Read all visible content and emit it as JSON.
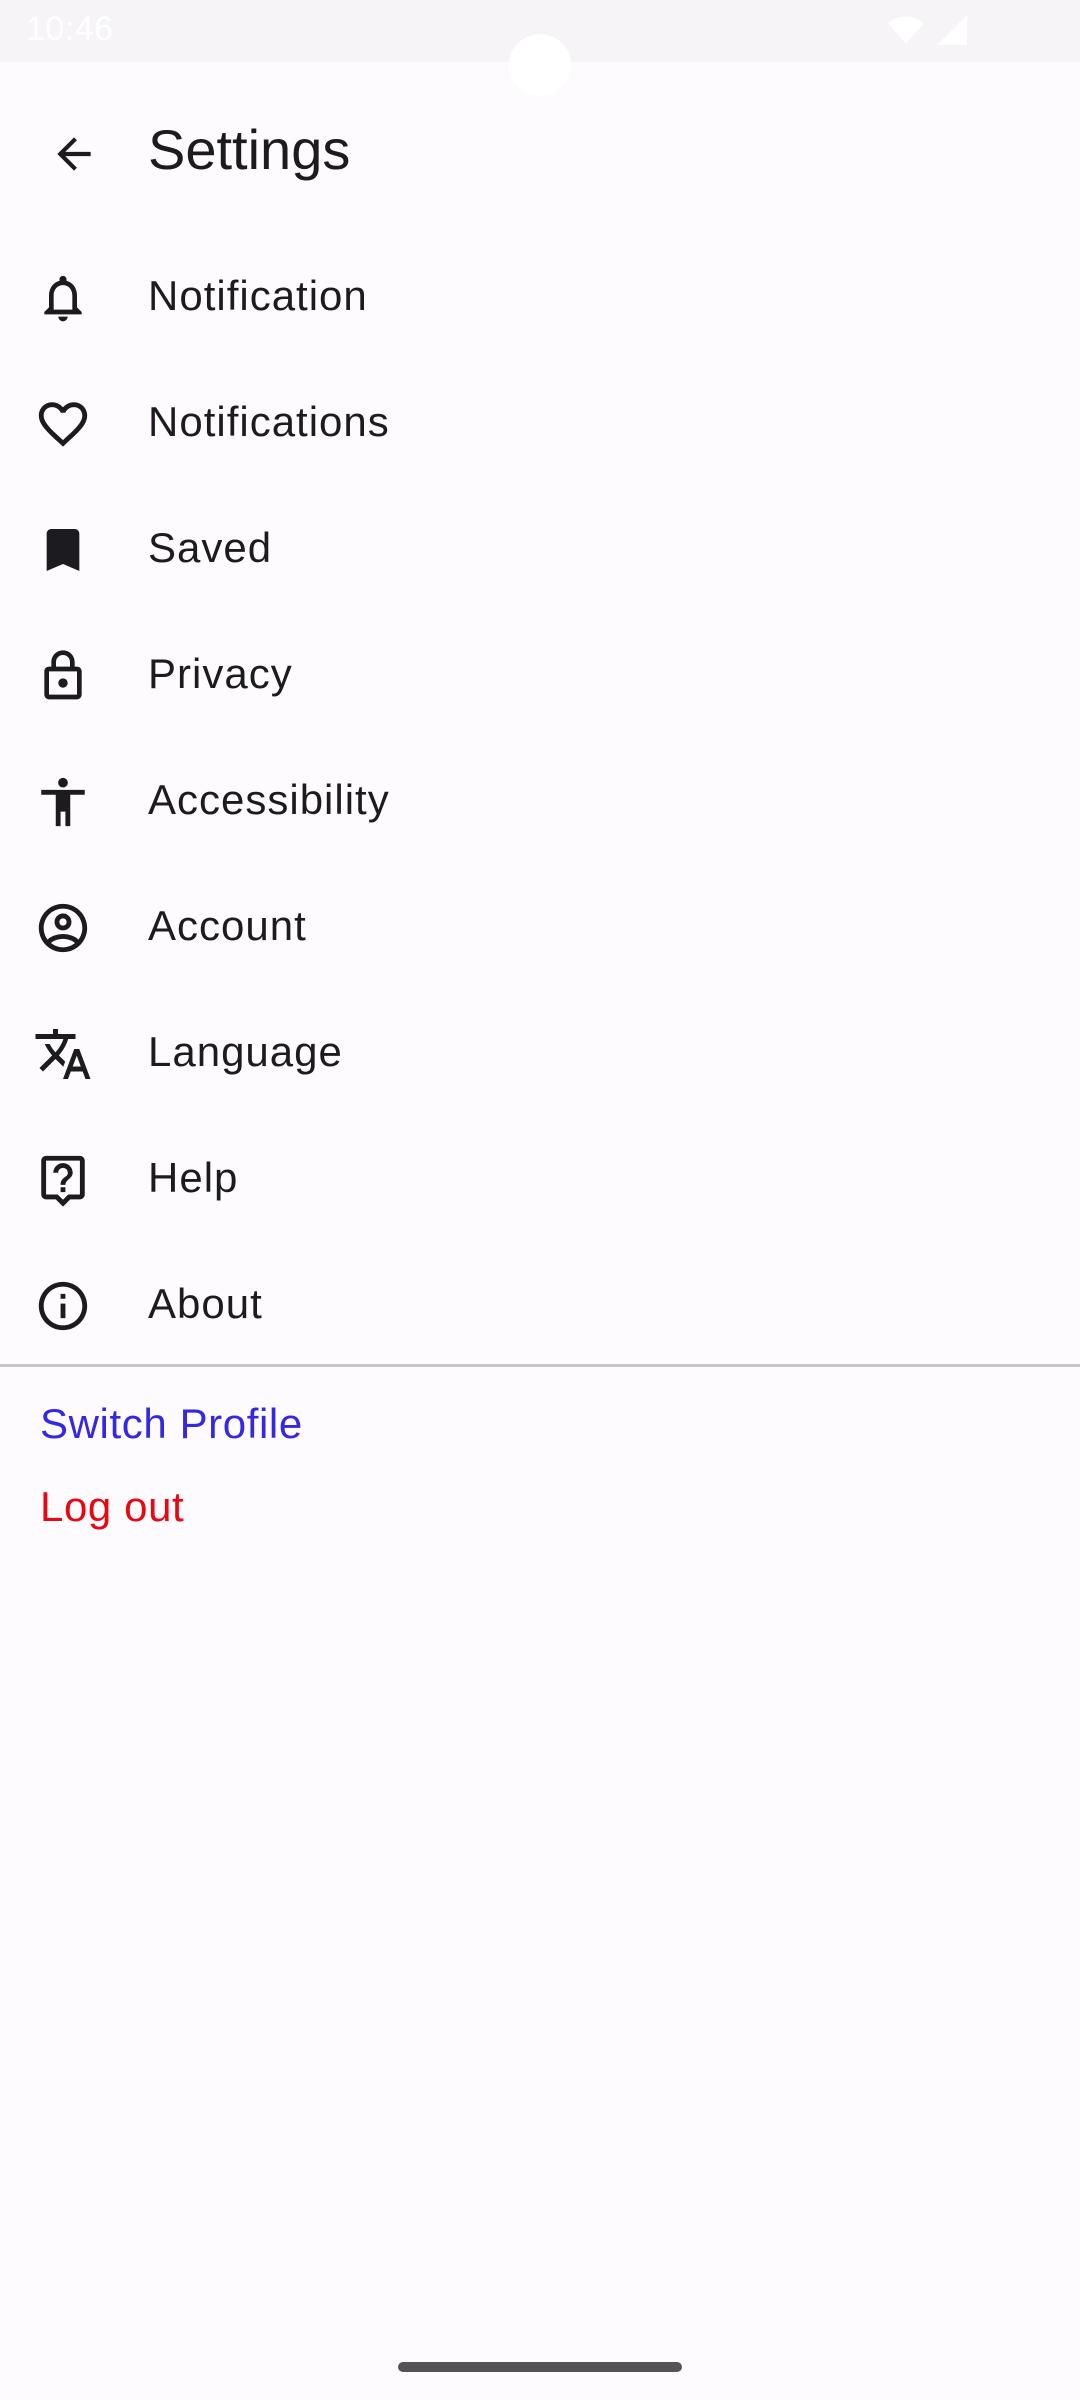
{
  "status_bar": {
    "time": "10:46",
    "icons": [
      "wifi-icon",
      "signal-icon"
    ]
  },
  "app_bar": {
    "back_icon": "arrow-back-icon",
    "title": "Settings"
  },
  "settings": {
    "items": [
      {
        "icon": "bell-icon",
        "label": "Notification"
      },
      {
        "icon": "heart-icon",
        "label": "Notifications"
      },
      {
        "icon": "bookmark-icon",
        "label": "Saved"
      },
      {
        "icon": "lock-icon",
        "label": "Privacy"
      },
      {
        "icon": "accessibility-icon",
        "label": "Accessibility"
      },
      {
        "icon": "account-circle-icon",
        "label": "Account"
      },
      {
        "icon": "translate-icon",
        "label": "Language"
      },
      {
        "icon": "help-icon",
        "label": "Help"
      },
      {
        "icon": "info-icon",
        "label": "About"
      }
    ]
  },
  "actions": {
    "switch_profile": "Switch Profile",
    "log_out": "Log out"
  },
  "colors": {
    "background": "#fdfbfe",
    "text": "#1c1b1f",
    "switch_profile": "#3528e0",
    "log_out": "#e50914",
    "divider": "#c8c6cb"
  }
}
